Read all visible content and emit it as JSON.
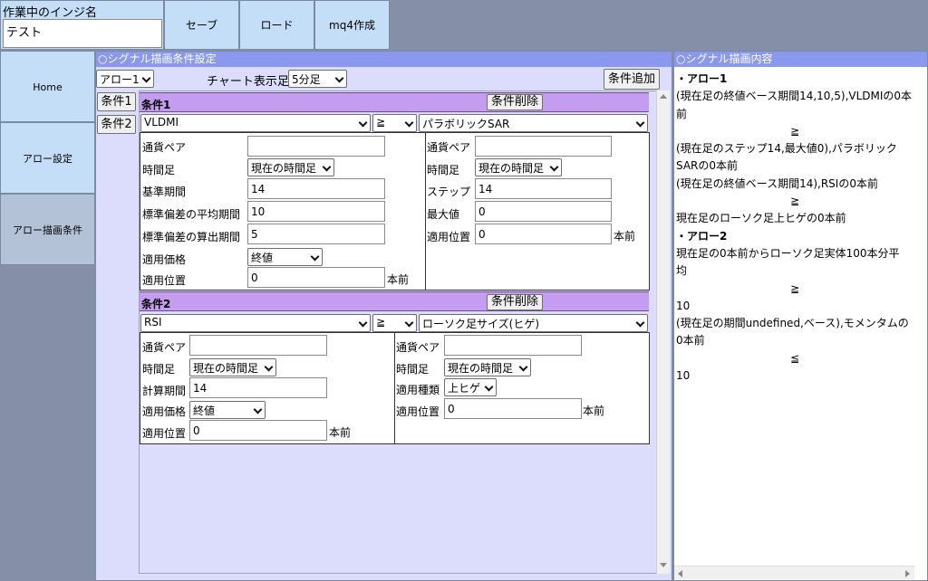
{
  "top": {
    "name_label": "作業中のインジ名",
    "name_value": "テスト",
    "save": "セーブ",
    "load": "ロード",
    "mq4": "mq4作成"
  },
  "nav": {
    "home": "Home",
    "arrow_settings": "アロー設定",
    "arrow_draw": "アロー描画条件"
  },
  "settings": {
    "title": "○シグナル描画条件設定",
    "arrow_select": "アロー1",
    "chart_label": "チャート表示足",
    "chart_select": "5分足",
    "add_condition": "条件追加",
    "tabs": [
      "条件1",
      "条件2"
    ]
  },
  "cond1": {
    "title": "条件1",
    "delete": "条件削除",
    "ind_left": "VLDMI",
    "op": "≧",
    "ind_right": "パラボリックSAR",
    "left": {
      "pair_label": "通貨ペア",
      "pair_value": "",
      "tf_label": "時間足",
      "tf_value": "現在の時間足",
      "period_label": "基準期間",
      "period_value": "14",
      "sd_avg_label": "標準偏差の平均期間",
      "sd_avg_value": "10",
      "sd_calc_label": "標準偏差の算出期間",
      "sd_calc_value": "5",
      "price_label": "適用価格",
      "price_value": "終値",
      "pos_label": "適用位置",
      "pos_value": "0",
      "pos_unit": "本前"
    },
    "right": {
      "pair_label": "通貨ペア",
      "pair_value": "",
      "tf_label": "時間足",
      "tf_value": "現在の時間足",
      "step_label": "ステップ",
      "step_value": "14",
      "max_label": "最大値",
      "max_value": "0",
      "pos_label": "適用位置",
      "pos_value": "0",
      "pos_unit": "本前"
    }
  },
  "cond2": {
    "title": "条件2",
    "delete": "条件削除",
    "ind_left": "RSI",
    "op": "≧",
    "ind_right": "ローソク足サイズ(ヒゲ)",
    "left": {
      "pair_label": "通貨ペア",
      "pair_value": "",
      "tf_label": "時間足",
      "tf_value": "現在の時間足",
      "calc_label": "計算期間",
      "calc_value": "14",
      "price_label": "適用価格",
      "price_value": "終値",
      "pos_label": "適用位置",
      "pos_value": "0",
      "pos_unit": "本前"
    },
    "right": {
      "pair_label": "通貨ペア",
      "pair_value": "",
      "tf_label": "時間足",
      "tf_value": "現在の時間足",
      "type_label": "適用種類",
      "type_value": "上ヒゲ",
      "pos_label": "適用位置",
      "pos_value": "0",
      "pos_unit": "本前"
    }
  },
  "signal": {
    "title": "○シグナル描画内容",
    "lines": [
      "・アロー1",
      "(現在足の終値ベース期間14,10,5),VLDMIの0本",
      "前",
      "≧",
      "(現在足のステップ14,最大値0),パラボリック",
      "SARの0本前",
      "(現在足の終値ベース期間14),RSIの0本前",
      "≧",
      "現在足のローソク足上ヒゲの0本前",
      "・アロー2",
      "現在足の0本前からローソク足実体100本分平",
      "均",
      "≧",
      "10",
      "(現在足の期間undefined,ベース),モメンタムの",
      "0本前",
      "≦",
      "10"
    ]
  }
}
